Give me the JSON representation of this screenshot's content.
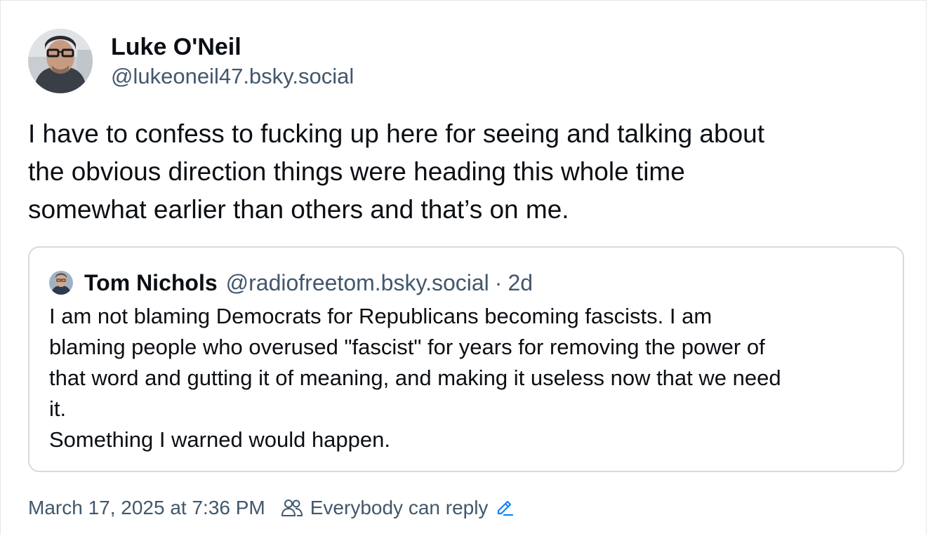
{
  "post": {
    "author": {
      "display_name": "Luke O'Neil",
      "handle": "@lukeoneil47.bsky.social"
    },
    "text": "I have to confess to fucking up here for seeing and talking about\nthe obvious direction things were heading this whole time\nsomewhat earlier than others and that’s on me.",
    "quoted_post": {
      "author": {
        "display_name": "Tom Nichols",
        "handle": "@radiofreetom.bsky.social"
      },
      "separator": "·",
      "time_ago": "2d",
      "text": "I am not blaming Democrats for Republicans becoming fascists. I am\nblaming people who overused \"fascist\" for years for removing the power of\nthat word and gutting it of meaning, and making it useless now that we need\nit.\nSomething I warned would happen."
    },
    "timestamp": "March 17, 2025 at 7:36 PM",
    "reply_setting": "Everybody can reply"
  },
  "icons": {
    "author_avatar": "avatar-photo",
    "quote_avatar": "avatar-photo",
    "reply_setting_icon": "people-icon",
    "edit_icon": "pencil-icon"
  },
  "colors": {
    "text_primary": "#0b0f14",
    "text_secondary": "#42576c",
    "border": "#d4dbe2",
    "accent": "#1083fe"
  }
}
